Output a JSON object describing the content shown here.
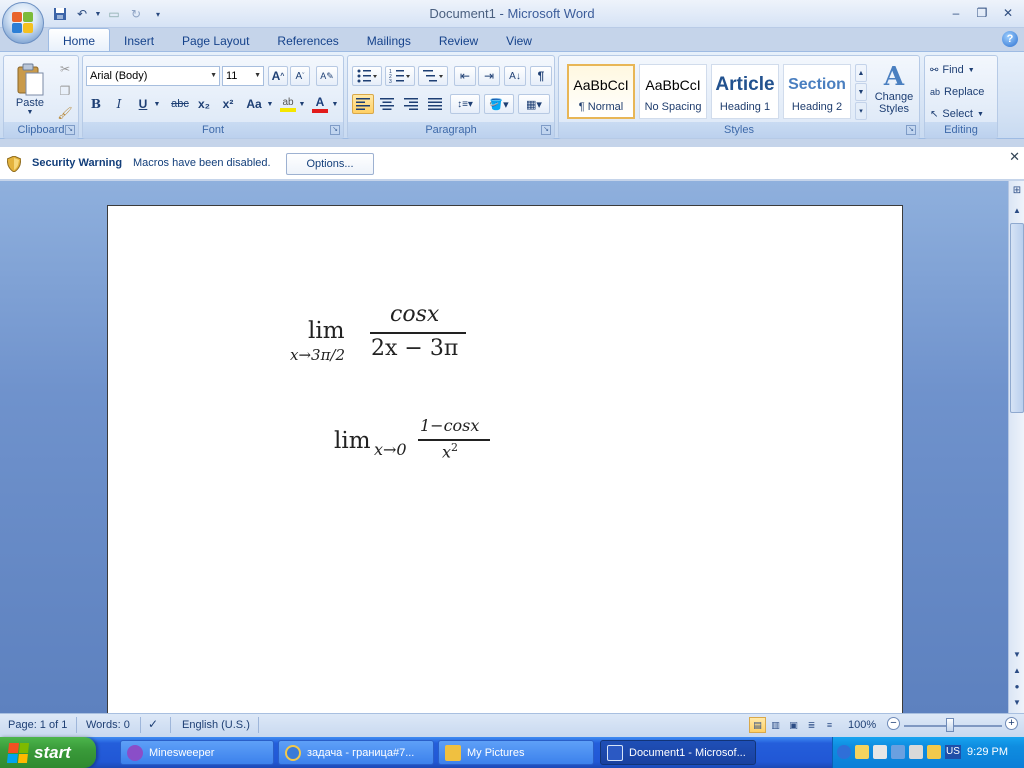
{
  "window": {
    "doc_name": "Document1",
    "separator": " - ",
    "app_name": "Microsoft Word",
    "minimize": "–",
    "restore": "❐",
    "close": "✕"
  },
  "ribbon_tabs": [
    "Home",
    "Insert",
    "Page Layout",
    "References",
    "Mailings",
    "Review",
    "View"
  ],
  "active_tab": "Home",
  "help": "?",
  "clipboard": {
    "paste_label": "Paste",
    "group_label": "Clipboard"
  },
  "font": {
    "font_name": "Arial (Body)",
    "font_size": "11",
    "group_label": "Font",
    "buttons": [
      "B",
      "I",
      "U",
      "abc",
      "x₂",
      "x²",
      "Aa"
    ]
  },
  "paragraph": {
    "group_label": "Paragraph",
    "pilcrow": "¶"
  },
  "styles": {
    "group_label": "Styles",
    "tiles": [
      {
        "sample": "AaBbCcI",
        "name": "¶ Normal"
      },
      {
        "sample": "AaBbCcI",
        "name": "No Spacing"
      },
      {
        "sample": "Article",
        "name": "Heading 1"
      },
      {
        "sample": "Section",
        "name": "Heading 2"
      }
    ],
    "change_styles_line1": "Change",
    "change_styles_line2": "Styles"
  },
  "editing": {
    "group_label": "Editing",
    "find": "Find",
    "replace": "Replace",
    "select": "Select"
  },
  "security": {
    "title": "Security Warning",
    "message": "Macros have been disabled.",
    "options_button": "Options...",
    "close": "✕"
  },
  "equations": {
    "eq1": {
      "lim": "lim",
      "sub": "x→3π/2",
      "numerator": "cosx",
      "denominator": "2x − 3π"
    },
    "eq2": {
      "lim": "lim",
      "sub": "x→0",
      "numerator": "1−cosx",
      "denominator_base": "x",
      "denominator_exp": "2"
    }
  },
  "statusbar": {
    "page": "Page: 1 of 1",
    "words": "Words: 0",
    "language": "English (U.S.)",
    "zoom": "100%",
    "zoom_minus": "−",
    "zoom_plus": "+"
  },
  "taskbar": {
    "start": "start",
    "tasks": [
      {
        "label": "Minesweeper",
        "icon_color": "#8a4ec8"
      },
      {
        "label": "задача - граница#7...",
        "icon_color": "#3b7bd8"
      },
      {
        "label": "My Pictures",
        "icon_color": "#f0c040"
      },
      {
        "label": "Document1 - Microsof...",
        "icon_color": "#2b59c3"
      }
    ],
    "language_indicator": "US",
    "clock": "9:29 PM"
  },
  "colors": {
    "ribbon_text": "#15428b",
    "taskbar_blue": "#245edb",
    "start_green": "#3a9b3a",
    "tray_blue": "#0f8de0"
  }
}
